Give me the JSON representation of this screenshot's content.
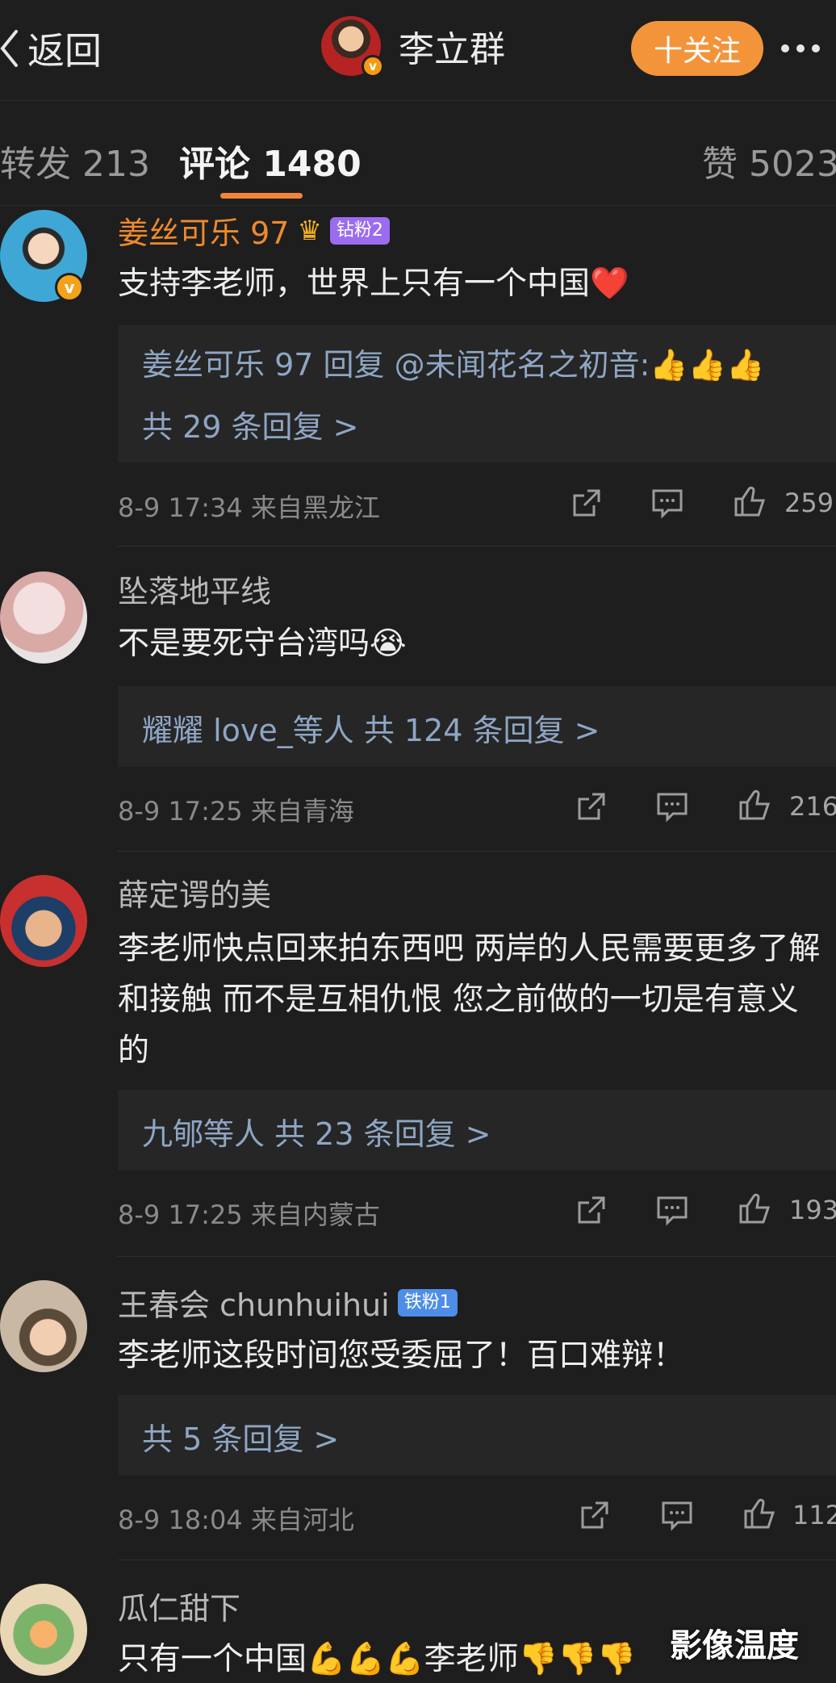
{
  "header": {
    "back_label": "返回",
    "owner_name": "李立群",
    "owner_verified": "v",
    "follow_label": "十关注"
  },
  "tabs": [
    {
      "label": "转发 213"
    },
    {
      "label": "评论 1480"
    },
    {
      "label": "赞 5023"
    }
  ],
  "comments": [
    {
      "name": "姜丝可乐 97",
      "badge": "钻粉2",
      "verified": "v",
      "text": "支持李老师，世界上只有一个中国❤️",
      "reply_lines": [
        "姜丝可乐 97 回复 @未闻花名之初音:👍👍👍",
        "共 29 条回复 >"
      ],
      "time": "8-9 17:34",
      "location": "来自黑龙江",
      "likes": "259"
    },
    {
      "name": "坠落地平线",
      "text": "不是要死守台湾吗😭",
      "reply_lines": [
        "耀耀 love_等人  共 124 条回复 >"
      ],
      "time": "8-9 17:25",
      "location": "来自青海",
      "likes": "216"
    },
    {
      "name": "薛定谔的美",
      "text": "李老师快点回来拍东西吧  两岸的人民需要更多了解和接触  而不是互相仇恨  您之前做的一切是有意义的",
      "reply_lines": [
        "九郇等人  共 23 条回复 >"
      ],
      "time": "8-9 17:25",
      "location": "来自内蒙古",
      "likes": "193"
    },
    {
      "name": "王春会 chunhuihui",
      "badge": "铁粉1",
      "text": "李老师这段时间您受委屈了！百口难辩！",
      "reply_lines": [
        "共 5 条回复 >"
      ],
      "time": "8-9 18:04",
      "location": "来自河北",
      "likes": "112"
    },
    {
      "name": "瓜仁甜下",
      "text": "只有一个中国💪💪💪李老师👎👎👎"
    }
  ],
  "watermark": "影像温度",
  "colors": {
    "accent": "#f3943b",
    "reply_link": "#8ea6c4",
    "background": "#1e1e1e"
  }
}
